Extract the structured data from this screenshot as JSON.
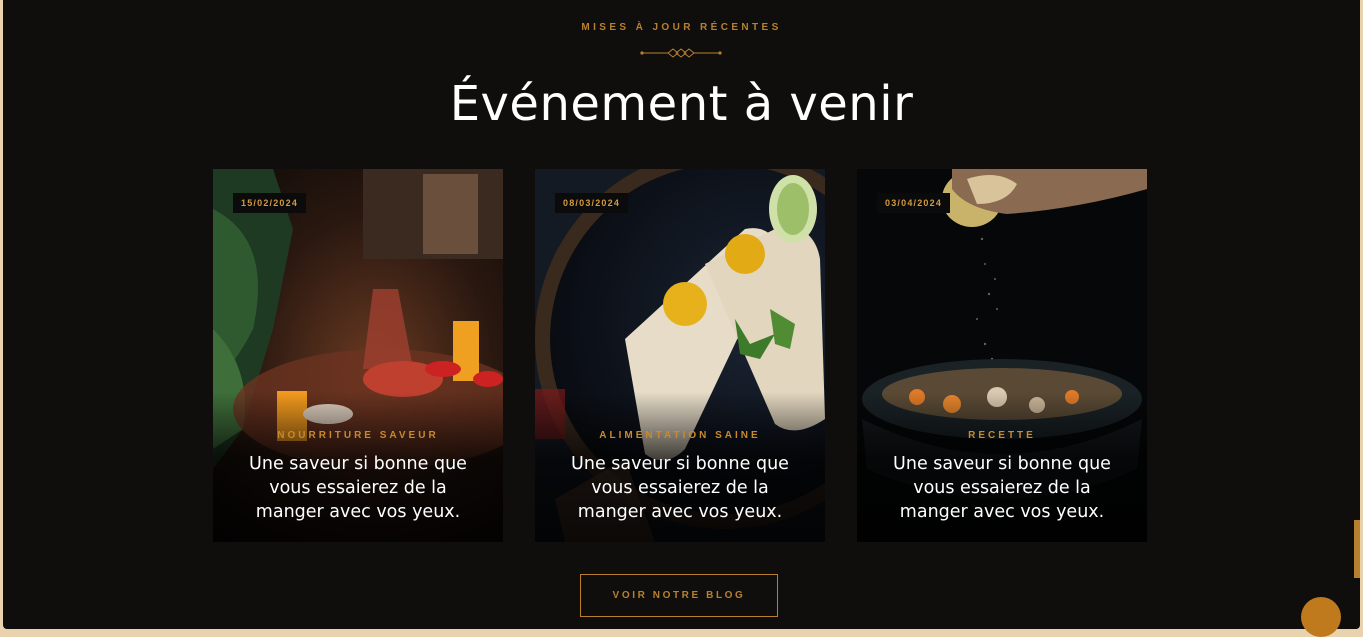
{
  "section": {
    "eyebrow": "MISES À JOUR RÉCENTES",
    "title": "Événement à venir"
  },
  "cards": [
    {
      "date": "15/02/2024",
      "category": "NOURRITURE SAVEUR",
      "title": "Une saveur si bonne que vous essaierez de la manger avec vos yeux.",
      "image": "restaurant-table-photo"
    },
    {
      "date": "08/03/2024",
      "category": "ALIMENTATION SAINE",
      "title": "Une saveur si bonne que vous essaierez de la manger avec vos yeux.",
      "image": "wraps-plate-photo"
    },
    {
      "date": "03/04/2024",
      "category": "RECETTE",
      "title": "Une saveur si bonne que vous essaierez de la manger avec vos yeux.",
      "image": "soup-bowl-photo"
    }
  ],
  "blog_button": "VOIR NOTRE BLOG",
  "colors": {
    "accent": "#b7802f",
    "background": "#0f0e0d",
    "outer": "#e9d3ae"
  }
}
